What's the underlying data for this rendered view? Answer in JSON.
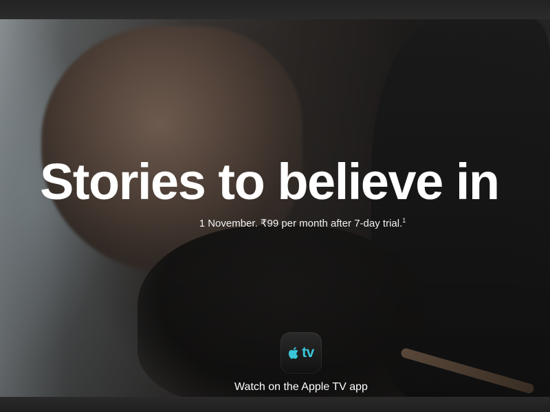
{
  "hero": {
    "headline": "Stories to believe in",
    "subline": "1 November. ₹99 per month after 7-day trial.",
    "footnote_marker": "1"
  },
  "app_icon": {
    "icon": "apple-tv-app-icon",
    "label": "tv",
    "accent_color": "#39c6d8"
  },
  "cta": {
    "label": "Watch on the Apple TV app"
  }
}
